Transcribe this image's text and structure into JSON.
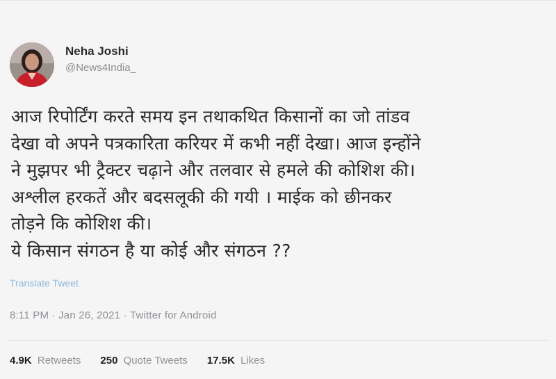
{
  "tweet": {
    "author": {
      "display_name": "Neha Joshi",
      "handle": "@News4India_"
    },
    "text_lines": [
      "आज रिपोर्टिंग करते समय इन तथाकथित किसानों का जो तांडव",
      "देखा वो अपने पत्रकारिता करियर में कभी नहीं देखा। आज इन्होंने",
      "ने मुझपर भी ट्रैक्टर चढ़ाने और तलवार से हमले की कोशिश की।",
      "अश्लील हरकतें और बदसलूकी की गयी । माईक को छीनकर",
      "तोड़ने कि कोशिश की।",
      "ये किसान संगठन है या कोई और संगठन ??"
    ],
    "translate_label": "Translate Tweet",
    "meta": {
      "time": "8:11 PM",
      "separator": "·",
      "date": "Jan 26, 2021",
      "source": "Twitter for Android"
    },
    "stats": {
      "retweets_count": "4.9K",
      "retweets_label": "Retweets",
      "quotes_count": "250",
      "quotes_label": "Quote Tweets",
      "likes_count": "17.5K",
      "likes_label": "Likes"
    }
  },
  "colors": {
    "background": "#f5f5f5",
    "link": "#8fb8de",
    "muted": "#8e9196"
  }
}
